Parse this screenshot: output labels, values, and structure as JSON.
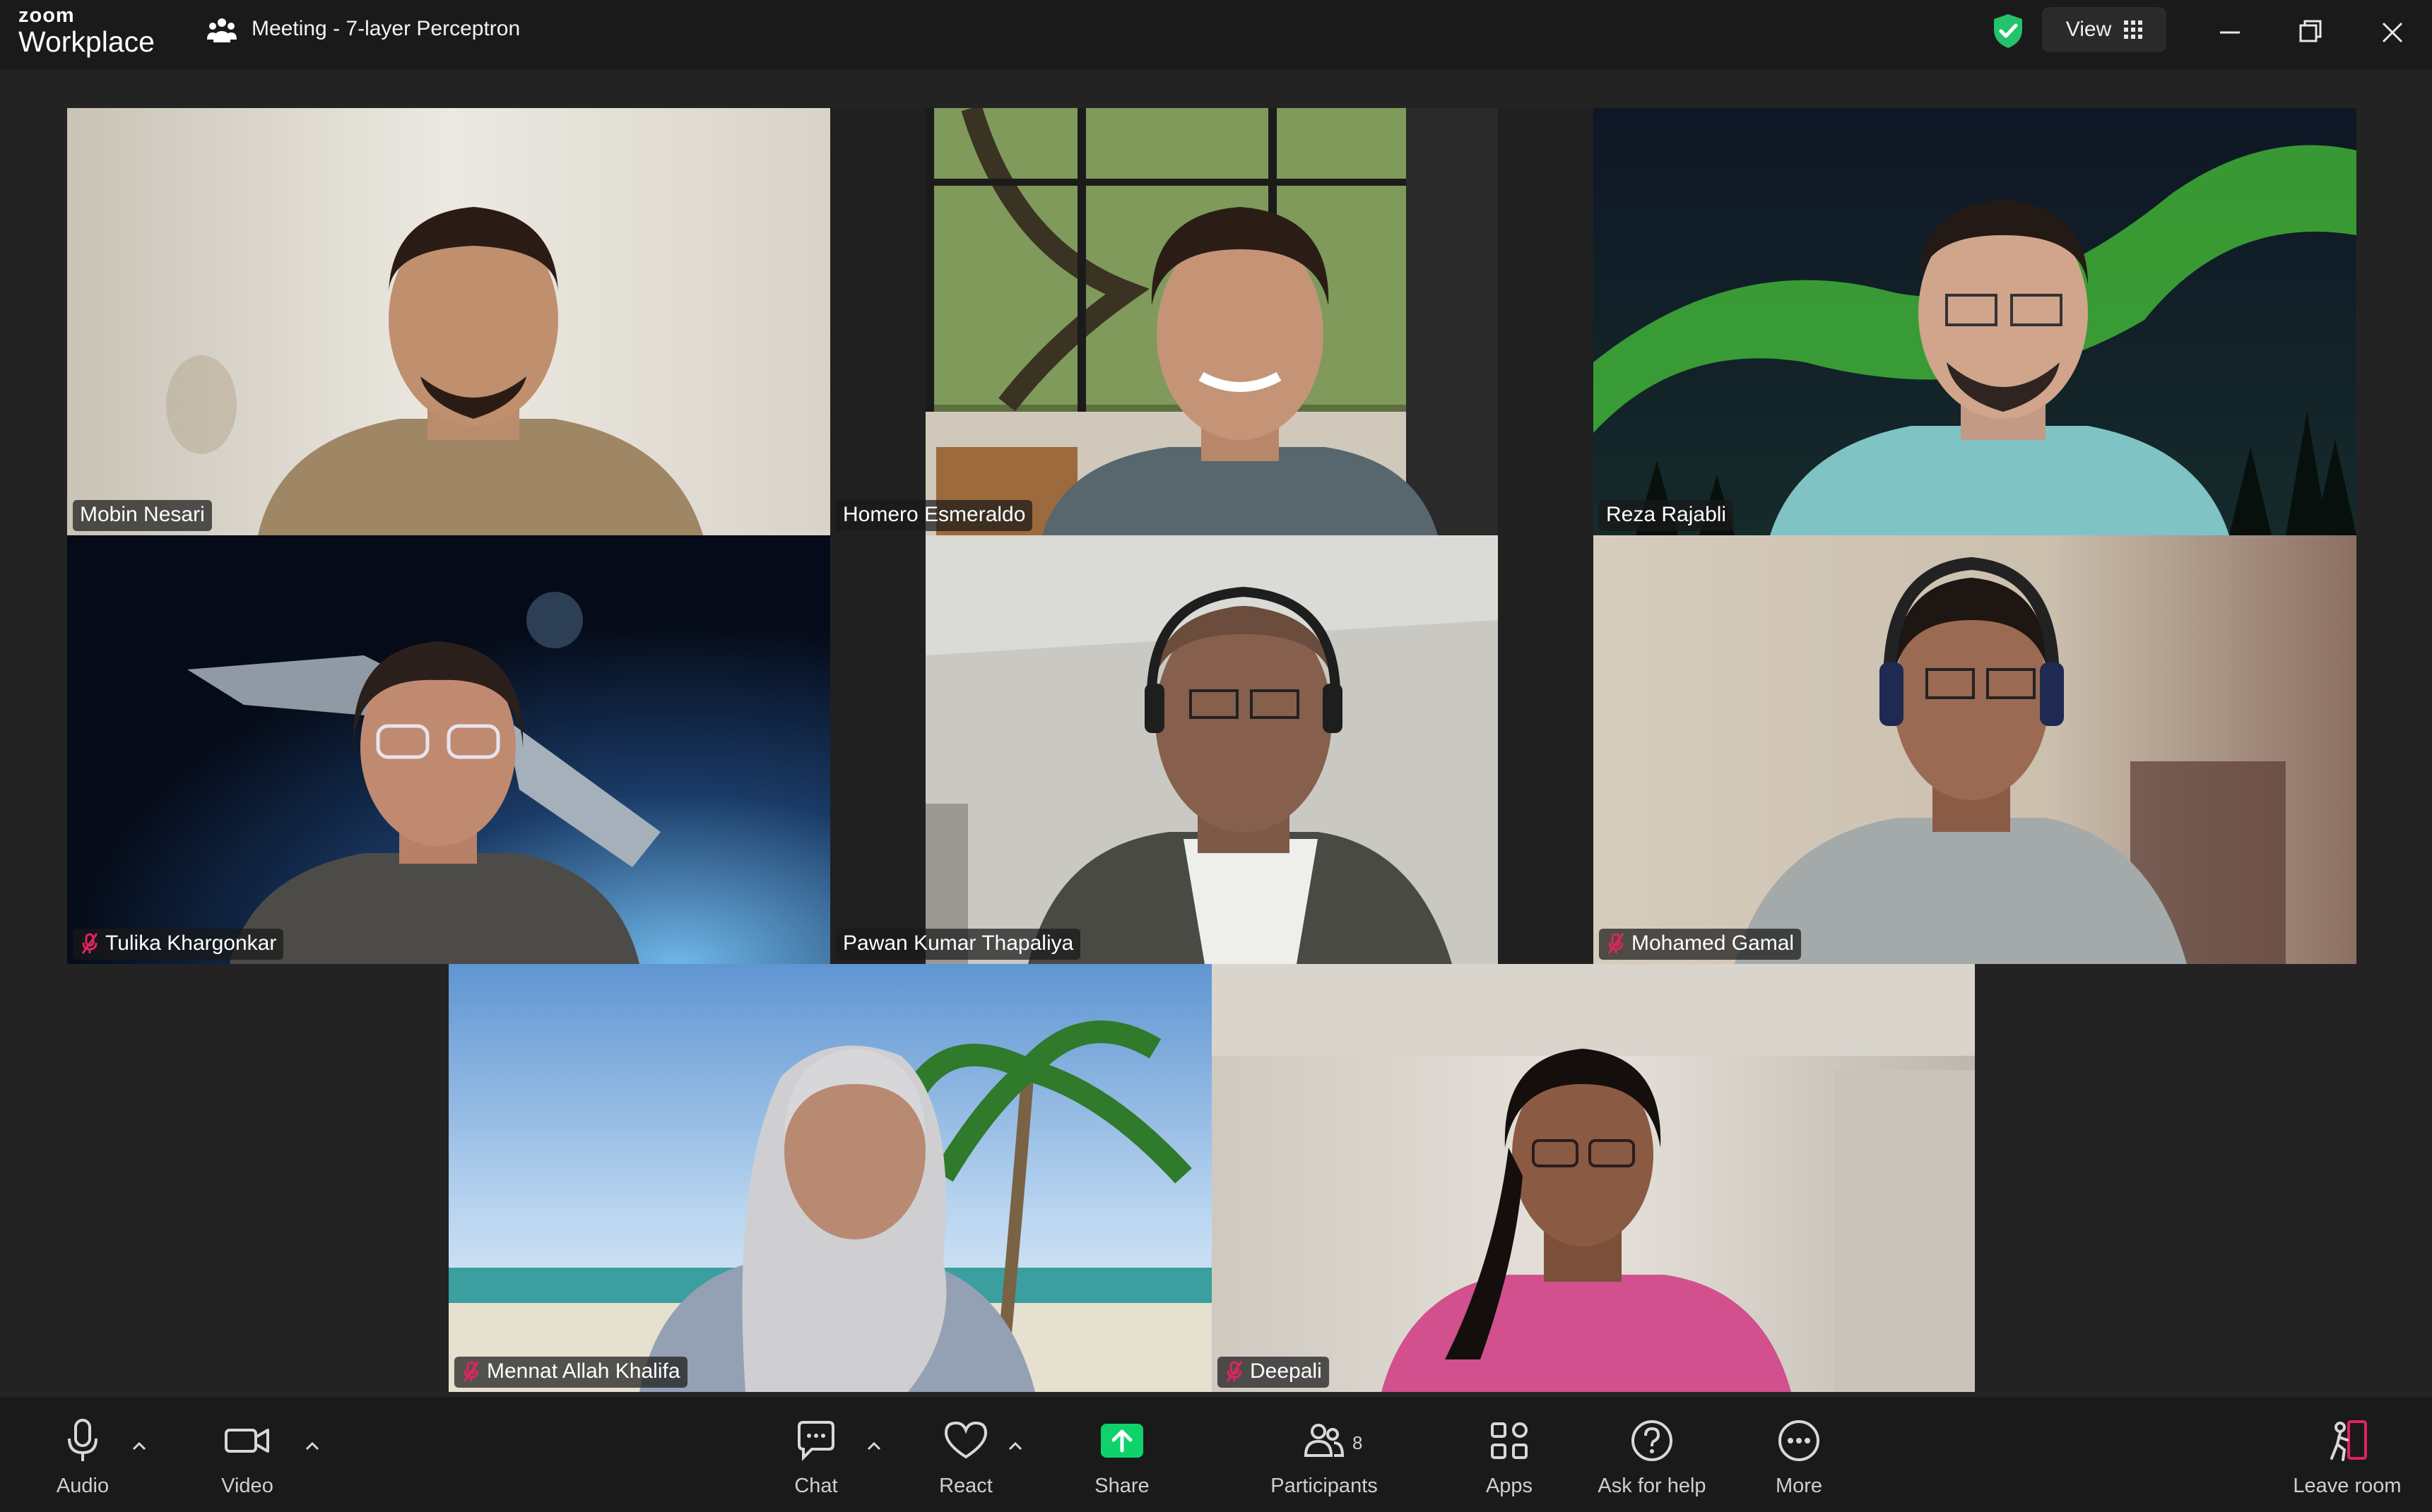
{
  "app": {
    "logo_top": "zoom",
    "logo_bottom": "Workplace",
    "meeting_title": "Meeting - 7-layer Perceptron",
    "view_label": "View"
  },
  "participants": [
    {
      "name": "Mobin Nesari",
      "muted": false,
      "bg": "#d8d3c8"
    },
    {
      "name": "Homero Esmeraldo",
      "muted": false,
      "bg": "#4e5e35"
    },
    {
      "name": "Reza Rajabli",
      "muted": false,
      "bg": "#0f1a2a"
    },
    {
      "name": "Tulika Khargonkar",
      "muted": true,
      "bg": "#0a1830"
    },
    {
      "name": "Pawan Kumar Thapaliya",
      "muted": false,
      "bg": "#c9c9c4",
      "active_speaker": true
    },
    {
      "name": "Mohamed Gamal",
      "muted": true,
      "bg": "#c9bca8"
    },
    {
      "name": "Mennat Allah Khalifa",
      "muted": true,
      "bg": "#7aa6d6"
    },
    {
      "name": "Deepali",
      "muted": true,
      "bg": "#d7d2c9"
    }
  ],
  "toolbar": {
    "audio": "Audio",
    "video": "Video",
    "chat": "Chat",
    "react": "React",
    "share": "Share",
    "participants": "Participants",
    "participants_count": "8",
    "apps": "Apps",
    "help": "Ask for help",
    "more": "More",
    "leave": "Leave room"
  },
  "colors": {
    "accent_green": "#23d97b",
    "share_green": "#0ed36b",
    "leave_red": "#e0245e"
  }
}
